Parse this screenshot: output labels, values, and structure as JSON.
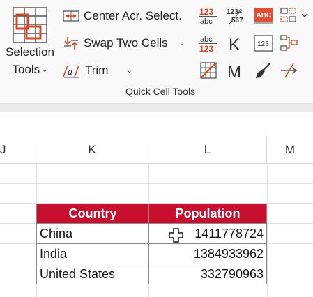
{
  "ribbon": {
    "selection_tools": {
      "line1": "Selection",
      "line2": "Tools",
      "chevron": "⌄"
    },
    "center_across": {
      "label": "Center Acr. Select."
    },
    "swap_cells": {
      "label": "Swap Two Cells",
      "chevron": "⌄"
    },
    "trim": {
      "label": "Trim",
      "chevron": "⌄"
    },
    "group_label": "Quick Cell Tools",
    "icon_texts": {
      "num_text_top": "123",
      "num_text_bottom": "abc",
      "num_stack_top": "1234",
      "num_stack_bottom": "567",
      "abc_box": "ABC",
      "text_top": "abc",
      "text_bottom": "123",
      "k_letter": "K",
      "m_letter": "M",
      "boxed_123": "123"
    },
    "icons": [
      "number-to-text-icon",
      "split-number-icon",
      "spell-check-icon",
      "select-range-icon",
      "text-to-number-icon",
      "k-format-icon",
      "number-box-icon",
      "arrange-range-icon",
      "table-convert-icon",
      "m-format-icon",
      "clear-brush-icon",
      "remove-strike-icon"
    ]
  },
  "columns": [
    "J",
    "K",
    "L",
    "M"
  ],
  "table": {
    "headers": [
      "Country",
      "Population"
    ],
    "rows": [
      [
        "China",
        "1411778724"
      ],
      [
        "India",
        "1384933962"
      ],
      [
        "United States",
        "332790963"
      ]
    ]
  },
  "colors": {
    "header_bg": "#c8102e",
    "icon_red": "#d24726",
    "icon_orange": "#e8692c"
  }
}
